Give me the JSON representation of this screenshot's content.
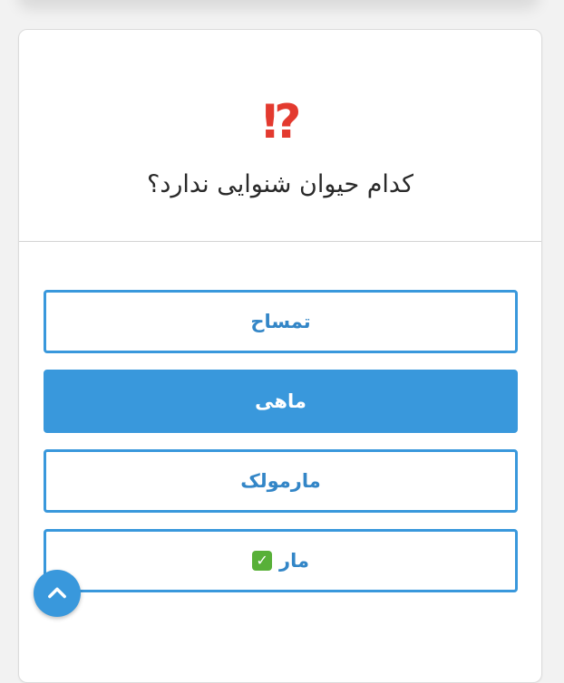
{
  "question": {
    "title": "کدام حیوان شنوایی ندارد؟"
  },
  "icons": {
    "question_mark": "exclamation-question-icon",
    "correct_check": "check-mark-icon",
    "scroll_up": "chevron-up-icon"
  },
  "options": [
    {
      "label": "تمساح",
      "selected": false,
      "marked_correct": false
    },
    {
      "label": "ماهی",
      "selected": true,
      "marked_correct": false
    },
    {
      "label": "مارمولک",
      "selected": false,
      "marked_correct": false
    },
    {
      "label": "مار",
      "selected": false,
      "marked_correct": true
    }
  ],
  "colors": {
    "accent": "#3998dc",
    "selected_text": "#ffffff",
    "question_mark": "#e33a2f",
    "check": "#58b038"
  }
}
